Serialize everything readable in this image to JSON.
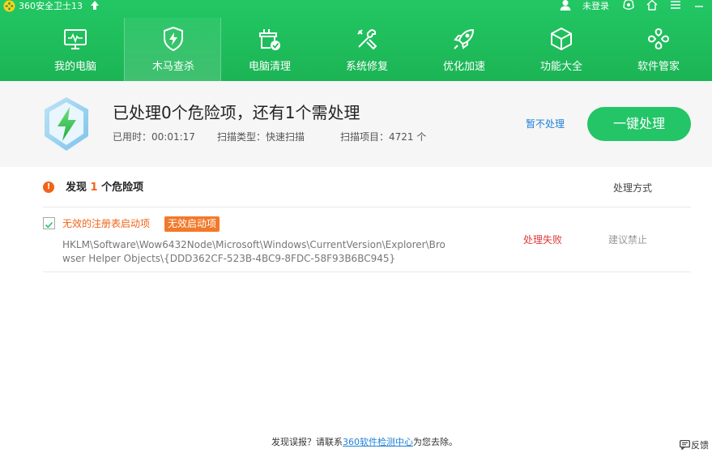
{
  "titlebar": {
    "title": "360安全卫士13",
    "login": "未登录",
    "icons": [
      "user-icon",
      "skin-icon",
      "home-icon",
      "menu-icon",
      "minimize-icon"
    ]
  },
  "nav": [
    {
      "label": "我的电脑",
      "icon": "monitor-icon"
    },
    {
      "label": "木马查杀",
      "icon": "shield-icon",
      "active": true
    },
    {
      "label": "电脑清理",
      "icon": "clean-icon"
    },
    {
      "label": "系统修复",
      "icon": "wrench-icon"
    },
    {
      "label": "优化加速",
      "icon": "rocket-icon"
    },
    {
      "label": "功能大全",
      "icon": "cube-icon"
    },
    {
      "label": "软件管家",
      "icon": "apps-icon"
    }
  ],
  "status": {
    "title": "已处理0个危险项，还有1个需处理",
    "elapsed": "已用时：00:01:17",
    "scan_type": "扫描类型：快速扫描",
    "scan_items": "扫描项目：4721 个",
    "later": "暂不处理",
    "fix_all": "一键处理"
  },
  "results": {
    "found_prefix": "发现",
    "found_count": "1",
    "found_suffix": "个危险项",
    "method_header": "处理方式",
    "items": [
      {
        "name": "无效的注册表启动项",
        "tag": "无效启动项",
        "path": "HKLM\\Software\\Wow6432Node\\Microsoft\\Windows\\CurrentVersion\\Explorer\\Browser Helper Objects\\{DDD362CF-523B-4BC9-8FDC-58F93B6BC945}",
        "result": "处理失败",
        "suggest": "建议禁止",
        "checked": true
      }
    ]
  },
  "footer": {
    "prefix": "发现误报？请联系",
    "link": "360软件检测中心",
    "suffix": "为您去除。",
    "feedback": "反馈"
  },
  "colors": {
    "brand_green": "#22c764",
    "warning_orange": "#f06419",
    "fail_red": "#e23838",
    "link_blue": "#1f7fd8"
  }
}
